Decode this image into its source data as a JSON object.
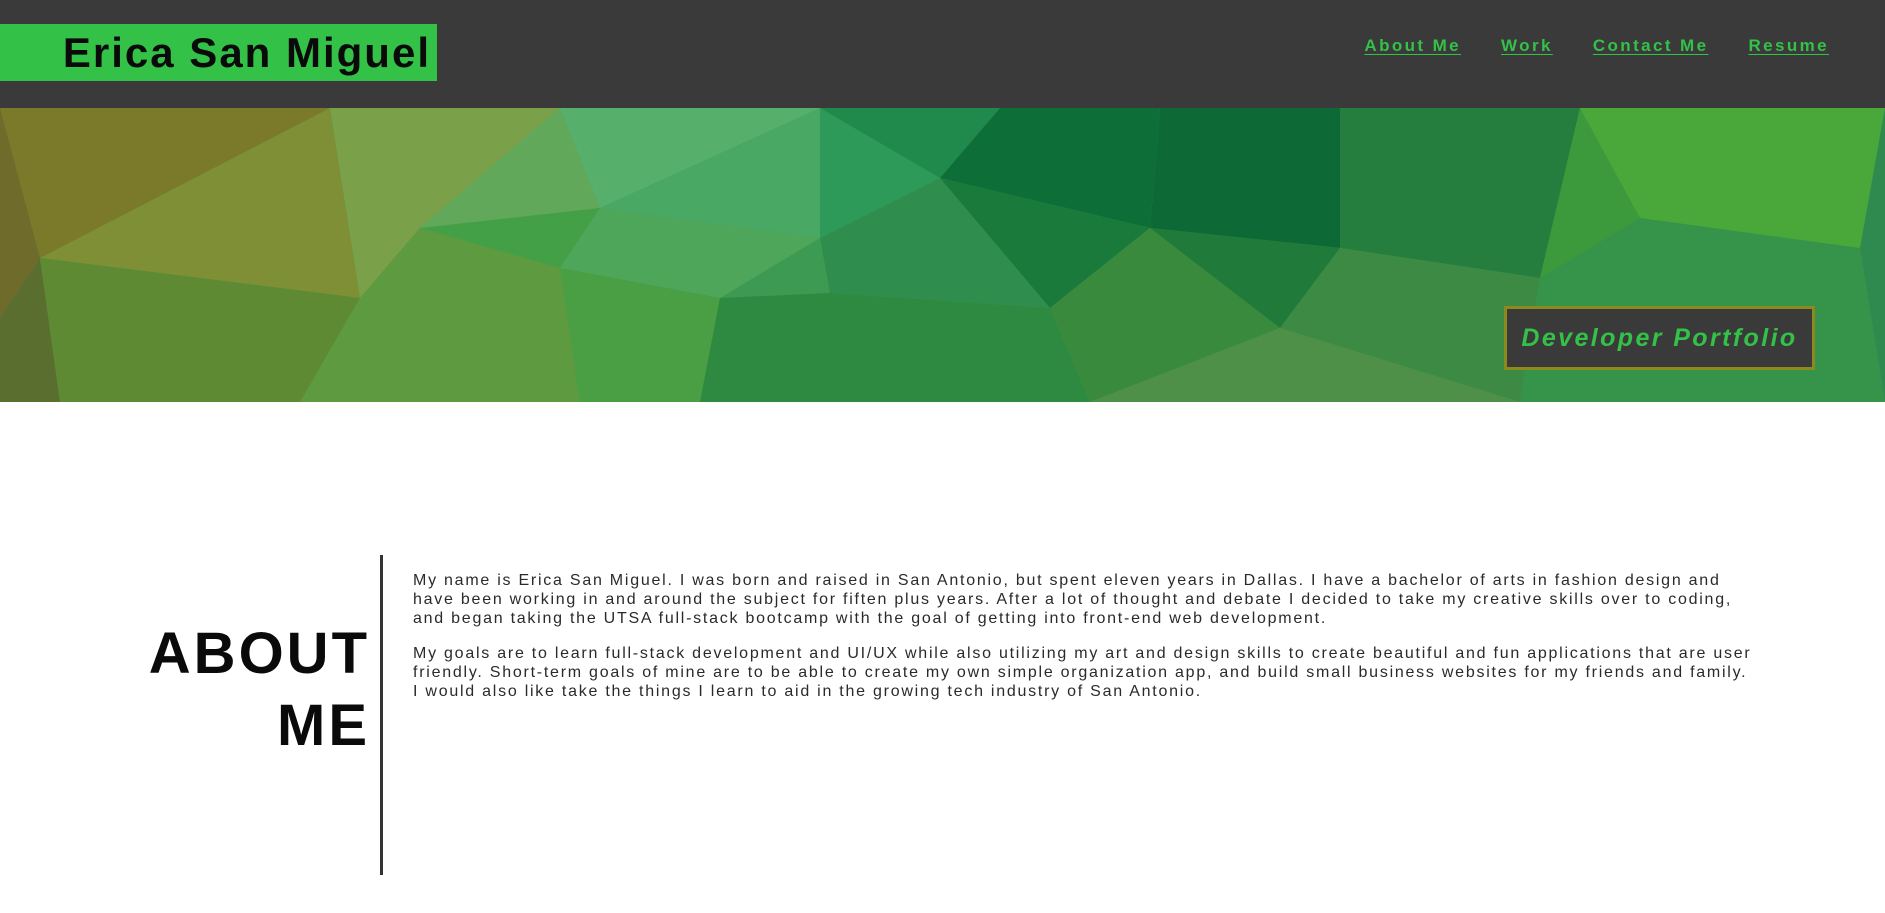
{
  "header": {
    "logo_text": "Erica San Miguel",
    "nav": [
      {
        "label": "About Me"
      },
      {
        "label": "Work"
      },
      {
        "label": "Contact Me"
      },
      {
        "label": "Resume"
      }
    ]
  },
  "hero": {
    "badge_text": "Developer Portfolio"
  },
  "about": {
    "heading_line1": "ABOUT",
    "heading_line2": "ME",
    "paragraphs": [
      "My name is Erica San Miguel. I was born and raised in San Antonio, but spent eleven years in Dallas. I have a bachelor of arts in fashion design and have been working in and around the subject for fiften plus years. After a lot of thought and debate I decided to take my creative skills over to coding, and began taking the UTSA full-stack bootcamp with the goal of getting into front-end web development.",
      "My goals are to learn full-stack development and UI/UX while also utilizing my art and design skills to create beautiful and fun applications that are user friendly. Short-term goals of mine are to be able to create my own simple organization app, and build small business websites for my friends and family. I would also like take the things I learn to aid in the growing tech industry of San Antonio."
    ]
  },
  "colors": {
    "header_bg": "#3a3a3a",
    "accent_green": "#33c148",
    "badge_border": "#8c8a1e",
    "text_dark": "#0a0a0a"
  }
}
